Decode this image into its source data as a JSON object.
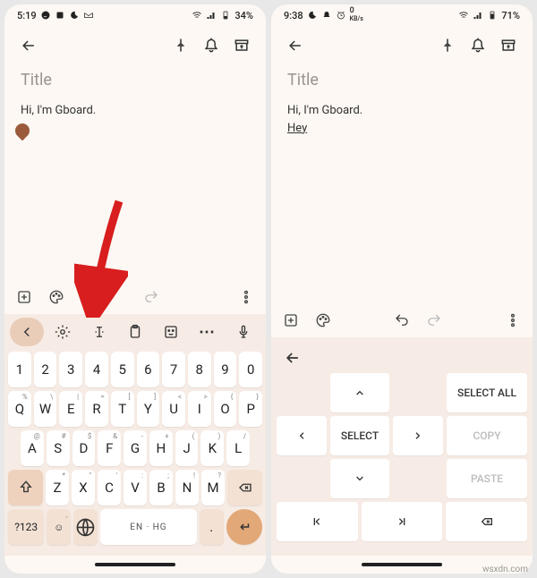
{
  "left": {
    "status": {
      "time": "5:19",
      "battery": "34%"
    },
    "title_placeholder": "Title",
    "body_line1": "Hi, I'm Gboard.",
    "format": {},
    "kbd": {
      "row_num": [
        "1",
        "2",
        "3",
        "4",
        "5",
        "6",
        "7",
        "8",
        "9",
        "0"
      ],
      "row_q": [
        "Q",
        "W",
        "E",
        "R",
        "T",
        "Y",
        "U",
        "I",
        "O",
        "P"
      ],
      "row_q_sup": [
        "%",
        "\\",
        "|",
        "=",
        "[",
        "]",
        "<",
        ">",
        "{",
        "}"
      ],
      "row_a": [
        "A",
        "S",
        "D",
        "F",
        "G",
        "H",
        "J",
        "K",
        "L"
      ],
      "row_a_sup": [
        "@",
        "#",
        "$",
        "&",
        "-",
        "+",
        "(",
        ")",
        "/"
      ],
      "row_z": [
        "Z",
        "X",
        "C",
        "V",
        "B",
        "N",
        "M"
      ],
      "row_z_sup": [
        "*",
        "\"",
        "'",
        ":",
        ";",
        "!",
        "?"
      ],
      "fn": "?123",
      "comma": ",",
      "space": "EN · HG",
      "period": "."
    }
  },
  "right": {
    "status": {
      "time": "9:38",
      "net": "0",
      "netunit": "KB/s",
      "battery": "71%"
    },
    "title_placeholder": "Title",
    "body_line1": "Hi, I'm Gboard.",
    "body_line2": "Hey",
    "panel": {
      "select_all": "SELECT ALL",
      "select": "SELECT",
      "copy": "COPY",
      "paste": "PASTE"
    }
  },
  "watermark": "wsxdn.com"
}
